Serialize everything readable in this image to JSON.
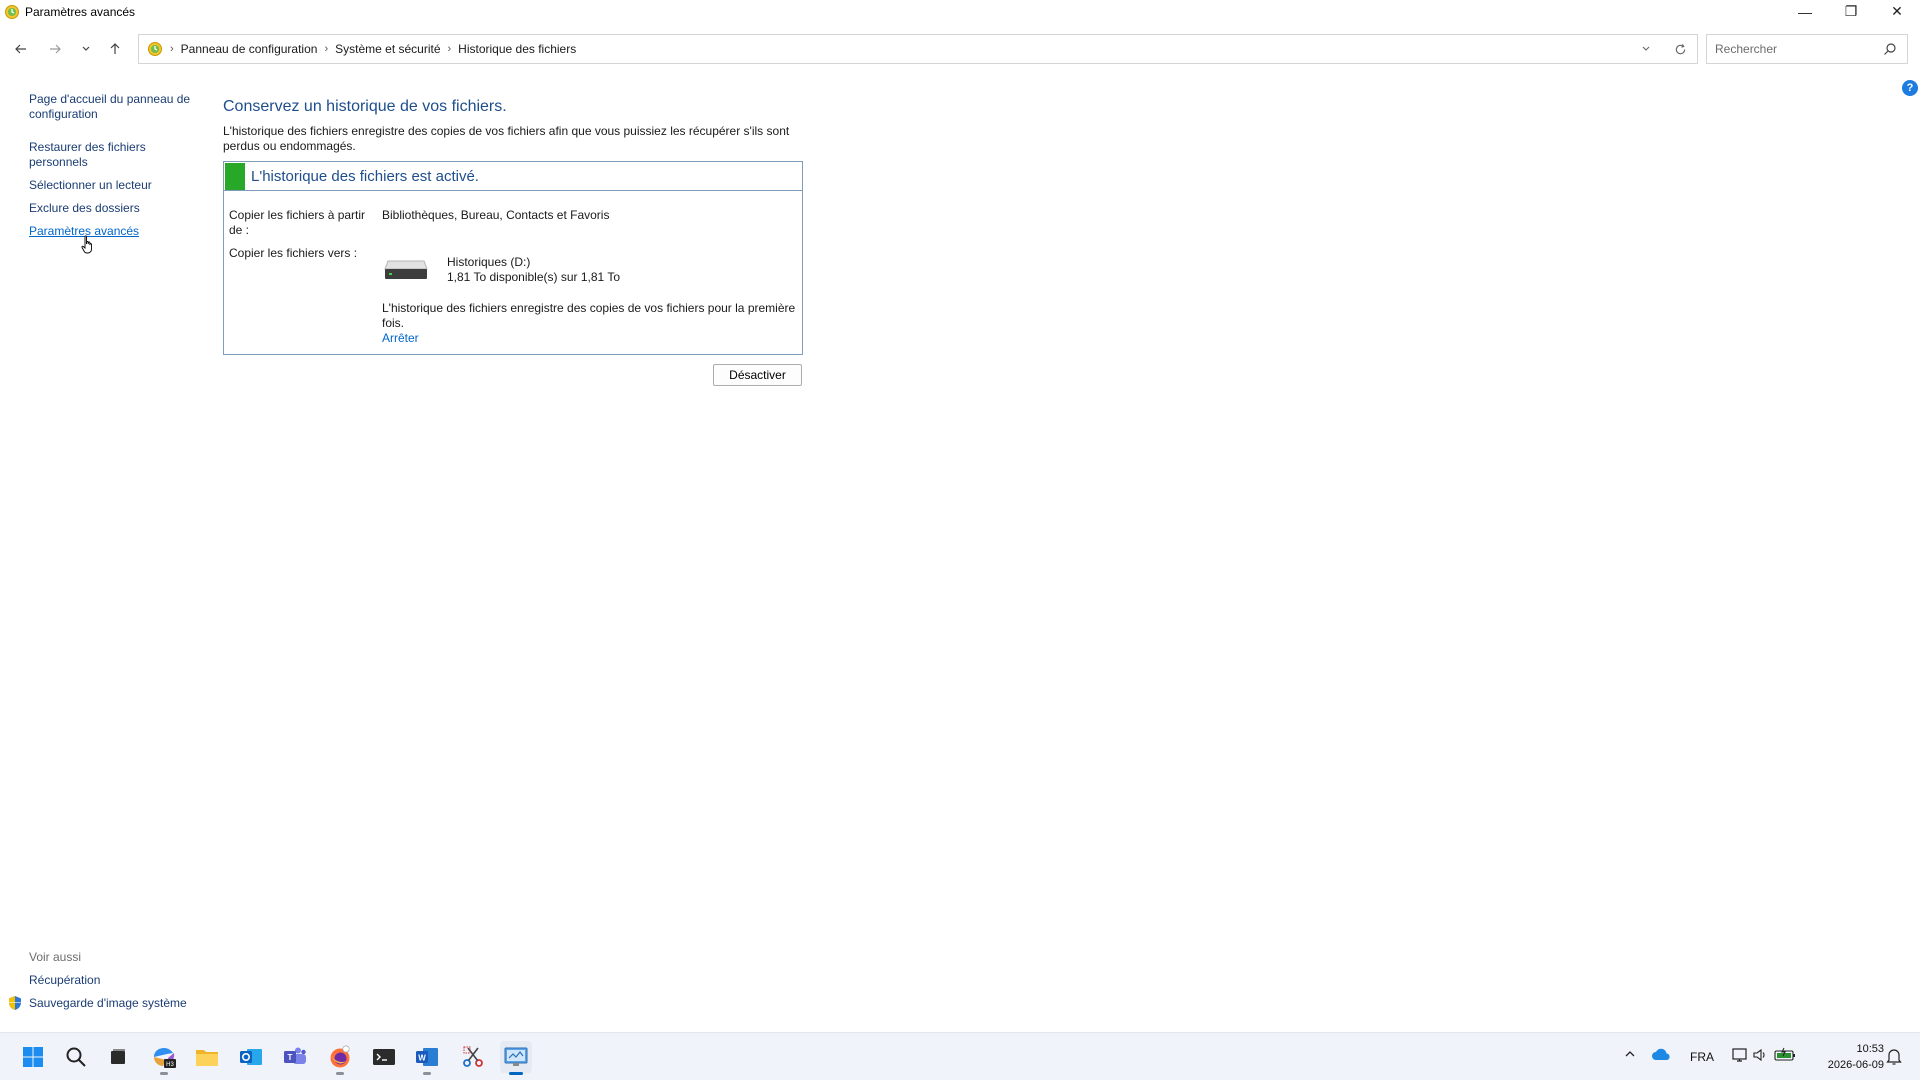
{
  "window": {
    "title": "Paramètres avancés",
    "controls": {
      "minimize": "—",
      "restore": "❐",
      "close": "✕"
    }
  },
  "nav": {
    "breadcrumbs": [
      "Panneau de configuration",
      "Système et sécurité",
      "Historique des fichiers"
    ],
    "search_placeholder": "Rechercher"
  },
  "left_pane": {
    "items": [
      "Page d'accueil du panneau de configuration",
      "Restaurer des fichiers personnels",
      "Sélectionner un lecteur",
      "Exclure des dossiers",
      "Paramètres avancés"
    ],
    "see_also": {
      "header": "Voir aussi",
      "links": [
        "Récupération",
        "Sauvegarde d'image système"
      ]
    }
  },
  "main": {
    "heading": "Conservez un historique de vos fichiers.",
    "description": "L'historique des fichiers enregistre des copies de vos fichiers afin que vous puissiez les récupérer s'ils sont perdus ou endommagés.",
    "status": {
      "title": "L'historique des fichiers est activé.",
      "color": "#27a828",
      "copy_from_label": "Copier les fichiers à partir de :",
      "copy_from_value": "Bibliothèques, Bureau, Contacts et Favoris",
      "copy_to_label": "Copier les fichiers vers :",
      "drive_name": "Historiques (D:)",
      "drive_space": "1,81 To disponible(s) sur 1,81 To",
      "note": "L'historique des fichiers enregistre des copies de vos fichiers pour la première fois.",
      "stop_link": "Arrêter"
    },
    "disable_button": "Désactiver",
    "help": "?"
  },
  "taskbar": {
    "apps": [
      "start-icon",
      "search-icon",
      "task-view-icon",
      "copilot-icon",
      "file-explorer-icon",
      "outlook-icon",
      "teams-icon",
      "firefox-icon",
      "terminal-icon",
      "word-icon",
      "snipping-tool-icon",
      "control-panel-icon"
    ],
    "tray": {
      "language": "FRA"
    },
    "time": "10:53",
    "date": "2026-06-09"
  }
}
